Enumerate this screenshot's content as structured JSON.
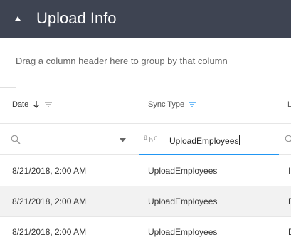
{
  "header": {
    "title": "Upload Info"
  },
  "group_panel": {
    "hint": "Drag a column header here to group by that column"
  },
  "columns": [
    {
      "label": "Date"
    },
    {
      "label": "Sync Type"
    },
    {
      "label": "L"
    }
  ],
  "filters": {
    "sync_type_value": "UploadEmployees"
  },
  "rows": [
    {
      "date": "8/21/2018, 2:00 AM",
      "sync_type": "UploadEmployees",
      "third": "I"
    },
    {
      "date": "8/21/2018, 2:00 AM",
      "sync_type": "UploadEmployees",
      "third": "D"
    },
    {
      "date": "8/21/2018, 2:00 AM",
      "sync_type": "UploadEmployees",
      "third": "D"
    }
  ],
  "colors": {
    "header_bg": "#3e4452",
    "accent": "#2196f3",
    "alt_row": "#f2f2f2"
  }
}
